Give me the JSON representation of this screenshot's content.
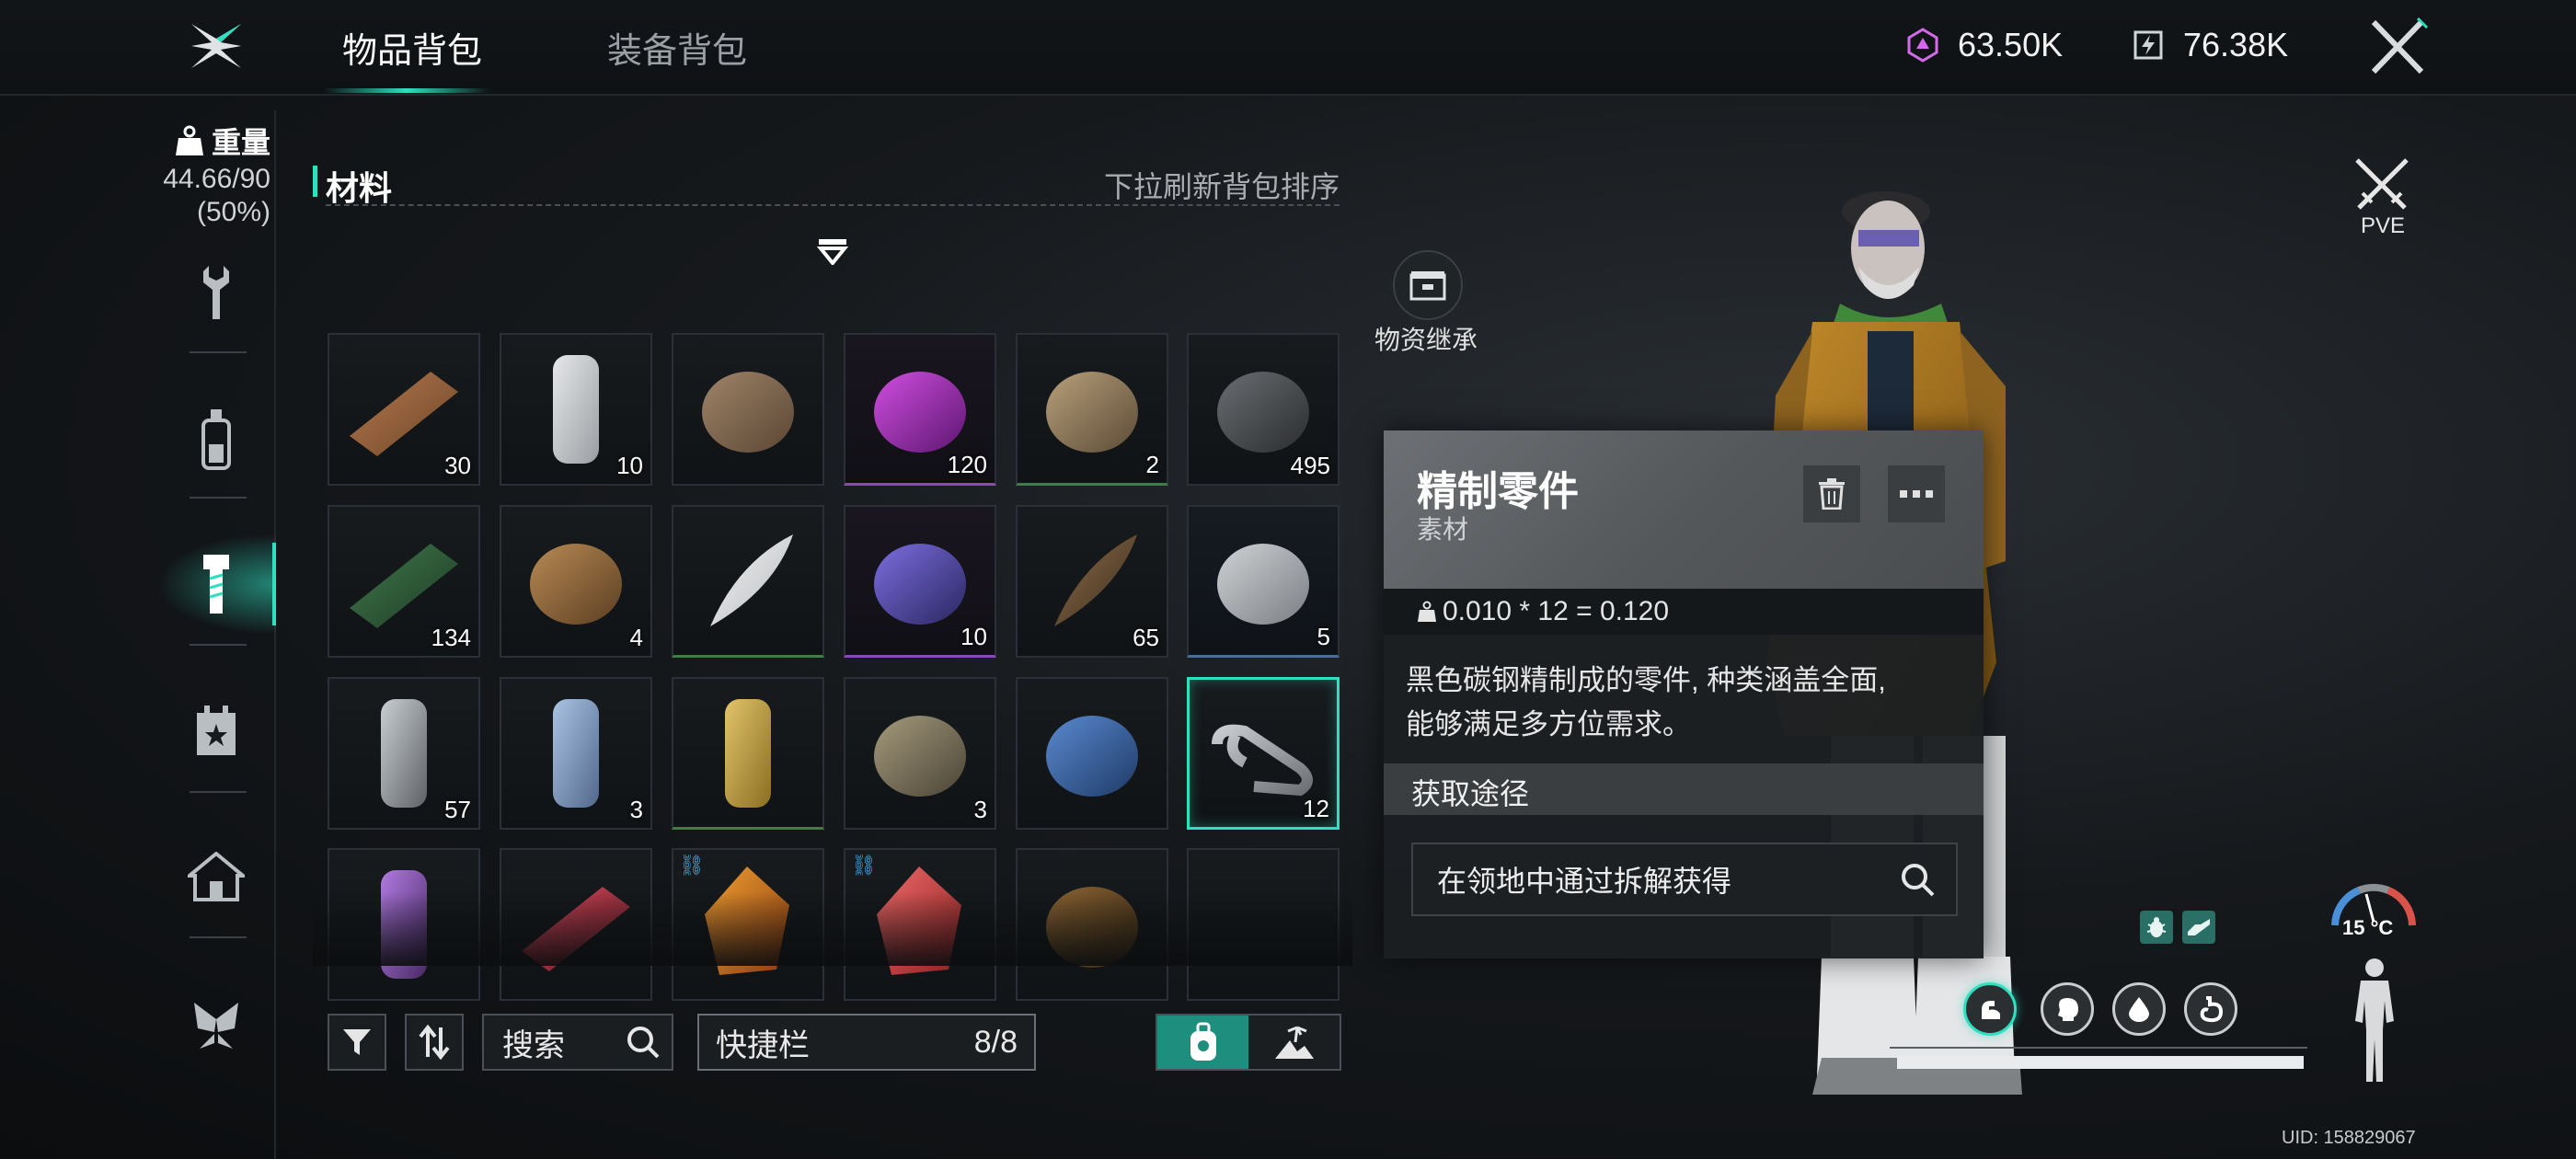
{
  "tabs": [
    {
      "label": "物品背包",
      "active": true
    },
    {
      "label": "装备背包",
      "active": false
    }
  ],
  "currency": [
    {
      "icon": "crystal-currency-icon",
      "value": "63.50K"
    },
    {
      "icon": "energy-currency-icon",
      "value": "76.38K"
    }
  ],
  "weight": {
    "label": "重量",
    "value": "44.66/90",
    "percent": "(50%)"
  },
  "sidebar": {
    "categories": [
      "wrench-icon",
      "bottle-icon",
      "bolt-icon",
      "calendar-star-icon",
      "house-icon",
      "butterfly-icon"
    ],
    "active_index": 2
  },
  "inventory": {
    "section_title": "材料",
    "refresh_hint": "下拉刷新背包排序",
    "slots": [
      {
        "item": "copper-ingot",
        "count": "30"
      },
      {
        "item": "white-cloth-roll",
        "count": "10"
      },
      {
        "item": "fertilizer-bag",
        "count": ""
      },
      {
        "item": "purple-orb",
        "count": "120",
        "rarity": "purple"
      },
      {
        "item": "chemical-bottle",
        "count": "2",
        "rarity": "green"
      },
      {
        "item": "coal-ore",
        "count": "495"
      },
      {
        "item": "circuit-board",
        "count": "134"
      },
      {
        "item": "dry-leaves",
        "count": "4"
      },
      {
        "item": "feather",
        "count": "",
        "rarity": "green"
      },
      {
        "item": "amethyst-ore",
        "count": "10",
        "rarity": "purple"
      },
      {
        "item": "wooden-sticks",
        "count": "65"
      },
      {
        "item": "stone-pile",
        "count": "5",
        "rarity": "blue"
      },
      {
        "item": "tube",
        "count": "57"
      },
      {
        "item": "blue-cloth-roll",
        "count": "3"
      },
      {
        "item": "gold-cloth-roll",
        "count": "",
        "rarity": "green"
      },
      {
        "item": "scrap-metal",
        "count": "3"
      },
      {
        "item": "blue-powder",
        "count": ""
      },
      {
        "item": "refined-parts",
        "count": "12",
        "selected": true
      },
      {
        "item": "purple-canister",
        "count": ""
      },
      {
        "item": "red-module",
        "count": ""
      },
      {
        "item": "amber-crystal",
        "count": "",
        "linked": true
      },
      {
        "item": "red-crystal",
        "count": "",
        "linked": true
      },
      {
        "item": "root-bundle",
        "count": ""
      },
      {
        "item": "empty",
        "count": ""
      }
    ]
  },
  "toolbar": {
    "search_label": "搜索",
    "quickbar_label": "快捷栏",
    "quickbar_count": "8/8"
  },
  "side_action": {
    "label": "物资继承"
  },
  "tooltip": {
    "name": "精制零件",
    "type": "素材",
    "weight_formula": "0.010 * 12 = 0.120",
    "description_line1": "黑色碳钢精制成的零件, 种类涵盖全面,",
    "description_line2": "能够满足多方位需求。",
    "obtain_title": "获取途径",
    "obtain_source": "在领地中通过拆解获得"
  },
  "hud": {
    "mode_label": "PVE",
    "temperature": "15 °C",
    "stat_progress": 1.0,
    "uid": "UID: 158829067"
  },
  "colors": {
    "accent": "#2ee0c0",
    "purple_rarity": "#8a48b8",
    "green_rarity": "#3d7d46"
  }
}
